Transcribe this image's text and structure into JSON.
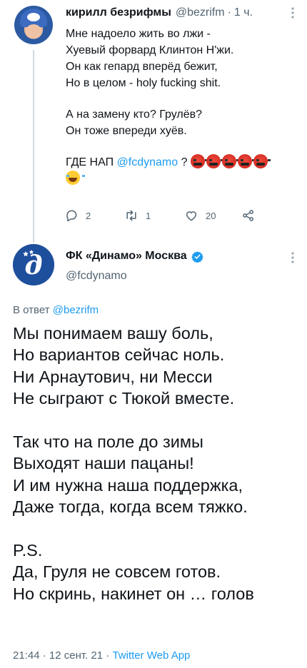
{
  "reply_tweet": {
    "author_name": "кирилл безрифмы",
    "handle": "@bezrifm",
    "separator": "·",
    "time": "1 ч.",
    "lines": [
      "Мне надоело жить во лжи -",
      "Хуевый форвард Клинтон Н'жи.",
      "Он как гепард вперёд бежит,",
      "Но в целом - holy fucking shit."
    ],
    "lines2": [
      "А на замену кто? Грулёв?",
      "Он тоже впереди хуёв."
    ],
    "question_prefix": "ГДЕ НАП ",
    "question_mention": "@fcdynamo",
    "question_suffix": " ?",
    "emoji": {
      "angry": "pouting-face-with-symbols",
      "angry_count": 5,
      "laugh": "face-with-tears-of-joy"
    },
    "actions": {
      "reply_count": "2",
      "retweet_count": "1",
      "like_count": "20"
    }
  },
  "main_tweet": {
    "author_name": "ФК «Динамо» Москва",
    "handle": "@fcdynamo",
    "reply_prefix": "В ответ ",
    "reply_mention": "@bezrifm",
    "stanza1": [
      "Мы понимаем вашу боль,",
      "Но вариантов сейчас ноль.",
      "Ни Арнаутович, ни Месси",
      "Не сыграют с Тюкой вместе."
    ],
    "stanza2": [
      "Так что на поле до зимы",
      "Выходят наши пацаны!",
      "И им нужна наша поддержка,",
      "Даже тогда, когда всем тяжко."
    ],
    "stanza3": [
      "P.S.",
      "Да, Груля не совсем готов.",
      "Но скринь, накинет он … голов"
    ],
    "time": "21:44",
    "separator": "·",
    "date": "12 сент. 21",
    "source": "Twitter Web App"
  },
  "colors": {
    "accent": "#1d9bf0",
    "secondary_text": "#536471",
    "primary_text": "#0f1419",
    "dynamo_blue": "#1e4f9c"
  }
}
